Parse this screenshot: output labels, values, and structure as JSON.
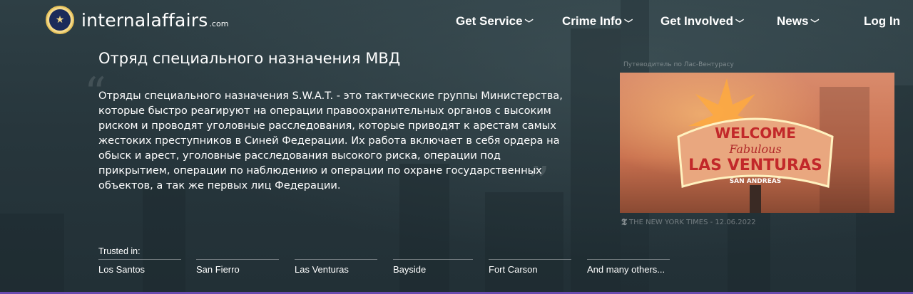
{
  "header": {
    "brand_name": "internalaffairs",
    "brand_tld": ".com",
    "logo_icon": "presidential-seal",
    "nav": [
      {
        "label": "Get Service",
        "has_dropdown": true
      },
      {
        "label": "Crime Info",
        "has_dropdown": true
      },
      {
        "label": "Get Involved",
        "has_dropdown": true
      },
      {
        "label": "News",
        "has_dropdown": true
      },
      {
        "label": "Log In",
        "has_dropdown": false
      }
    ]
  },
  "main": {
    "title": "Отряд специального назначения МВД",
    "description": "Отряды специального назначения S.W.A.T. - это тактические группы Министерства, которые быстро реагируют на операции правоохранительных органов с высоким риском и проводят уголовные расследования, которые приводят к арестам самых жестоких преступников в Синей Федерации. Их работа включает в себя ордера на обыск и арест, уголовные расследования высокого риска, операции под прикрытием, операции по наблюдению и операции по охране государственных объектов, а так же первых лиц Федерации."
  },
  "photo": {
    "caption": "Путеводитель по Лас-Вентурасу",
    "sign_welcome": "WELCOME",
    "sign_fabulous": "Fabulous",
    "sign_city": "LAS VENTURAS",
    "sign_state": "SAN ANDREAS",
    "credit": "THE NEW YORK TIMES - 12.06.2022",
    "credit_icon": "nyt-logo-icon"
  },
  "trusted": {
    "label": "Trusted in:",
    "cities": [
      "Los Santos",
      "San Fierro",
      "Las Venturas",
      "Bayside",
      "Fort Carson",
      "And many others..."
    ]
  },
  "colors": {
    "background": "#2b3a40",
    "accent_bar": "#6b4bb0",
    "seal_gold": "#f4d98a"
  }
}
